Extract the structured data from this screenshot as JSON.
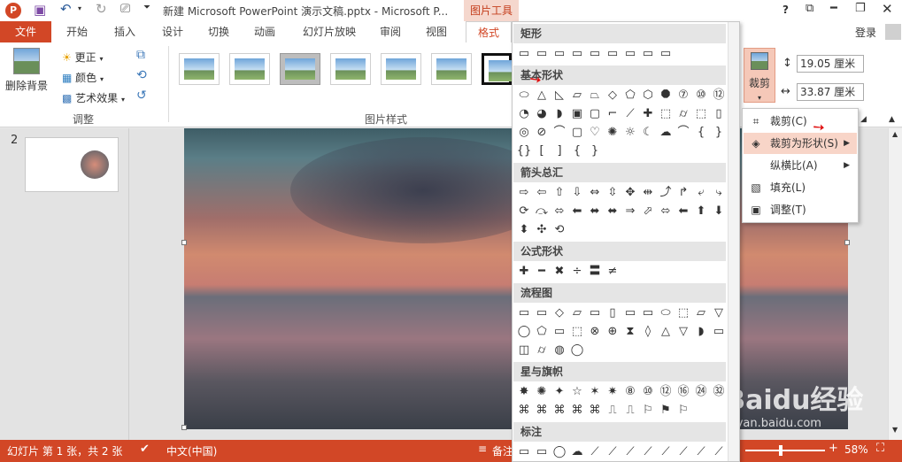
{
  "title_bar": {
    "doc_title": "新建 Microsoft PowerPoint 演示文稿.pptx - Microsoft P...",
    "context_group": "图片工具",
    "help": "?",
    "signin": "登录"
  },
  "tabs": [
    "文件",
    "开始",
    "插入",
    "设计",
    "切换",
    "动画",
    "幻灯片放映",
    "审阅",
    "视图",
    "格式"
  ],
  "ribbon": {
    "remove_bg": "删除背景",
    "corrections": "更正",
    "color": "颜色",
    "artistic": "艺术效果",
    "adjust_group": "调整",
    "styles_group": "图片样式",
    "crop": "裁剪",
    "height": "19.05 厘米",
    "width": "33.87 厘米"
  },
  "slides_panel": {
    "slide_number": "2"
  },
  "shape_menu": {
    "sections": [
      {
        "title": "矩形",
        "rows": [
          [
            "▭",
            "▭",
            "▭",
            "▭",
            "▭",
            "▭",
            "▭",
            "▭",
            "▭"
          ]
        ]
      },
      {
        "title": "基本形状",
        "rows": [
          [
            "⬭",
            "△",
            "◺",
            "▱",
            "⏢",
            "◇",
            "⬠",
            "⬡",
            "⯃",
            "⑦",
            "⑩",
            "⑫"
          ],
          [
            "◔",
            "◕",
            "◗",
            "▣",
            "▢",
            "⌐",
            "⟋",
            "✚",
            "⬚",
            "⌭",
            "⬚",
            "▯"
          ],
          [
            "◎",
            "⊘",
            "⌒",
            "▢",
            "♡",
            "✺",
            "☼",
            "☾",
            "☁",
            "⌒",
            "{",
            "}"
          ],
          [
            "{}",
            "[",
            "]",
            "{",
            "}"
          ]
        ]
      },
      {
        "title": "箭头总汇",
        "rows": [
          [
            "⇨",
            "⇦",
            "⇧",
            "⇩",
            "⇔",
            "⇳",
            "✥",
            "⇹",
            "⤴",
            "↱",
            "⤶",
            "⤷"
          ],
          [
            "⟳",
            "⤼",
            "⬄",
            "⬅",
            "⬌",
            "⬌",
            "⇒",
            "⬀",
            "⬄",
            "⬅",
            "⬆",
            "⬇"
          ],
          [
            "⬍",
            "✣",
            "⟲"
          ]
        ]
      },
      {
        "title": "公式形状",
        "rows": [
          [
            "✚",
            "━",
            "✖",
            "÷",
            "〓",
            "≠"
          ]
        ]
      },
      {
        "title": "流程图",
        "rows": [
          [
            "▭",
            "▭",
            "◇",
            "▱",
            "▭",
            "▯",
            "▭",
            "▭",
            "⬭",
            "⬚",
            "▱",
            "▽"
          ],
          [
            "◯",
            "⬠",
            "▭",
            "⬚",
            "⊗",
            "⊕",
            "⧗",
            "◊",
            "△",
            "▽",
            "◗",
            "▭"
          ],
          [
            "◫",
            "⌭",
            "◍",
            "◯"
          ]
        ]
      },
      {
        "title": "星与旗帜",
        "rows": [
          [
            "✸",
            "✺",
            "✦",
            "☆",
            "✶",
            "✷",
            "⑧",
            "⑩",
            "⑫",
            "⑯",
            "㉔",
            "㉜"
          ],
          [
            "⌘",
            "⌘",
            "⌘",
            "⌘",
            "⌘",
            "⎍",
            "⎍",
            "⚐",
            "⚑",
            "⚐"
          ]
        ]
      },
      {
        "title": "标注",
        "rows": [
          [
            "▭",
            "▭",
            "◯",
            "☁",
            "⟋",
            "⟋",
            "⟋",
            "⟋",
            "⟋",
            "⟋",
            "⟋",
            "⟋"
          ]
        ]
      }
    ]
  },
  "crop_menu": {
    "items": [
      {
        "label": "裁剪(C)",
        "icon": "crop-icon",
        "arrow": ""
      },
      {
        "label": "裁剪为形状(S)",
        "icon": "crop-shape-icon",
        "arrow": "▶"
      },
      {
        "label": "纵横比(A)",
        "icon": "",
        "arrow": "▶"
      },
      {
        "label": "填充(L)",
        "icon": "fill-icon",
        "arrow": ""
      },
      {
        "label": "调整(T)",
        "icon": "fit-icon",
        "arrow": ""
      }
    ]
  },
  "status_bar": {
    "slide_info": "幻灯片 第 1 张，共 2 张",
    "language": "中文(中国)",
    "notes": "备注",
    "zoom": "58%"
  },
  "watermark": {
    "brand": "Baidu经验",
    "url": "jingyan.baidu.com"
  },
  "colors": {
    "accent": "#d24726",
    "ribbon_bg": "#ffffff",
    "menu_section": "#e5e5e5"
  }
}
